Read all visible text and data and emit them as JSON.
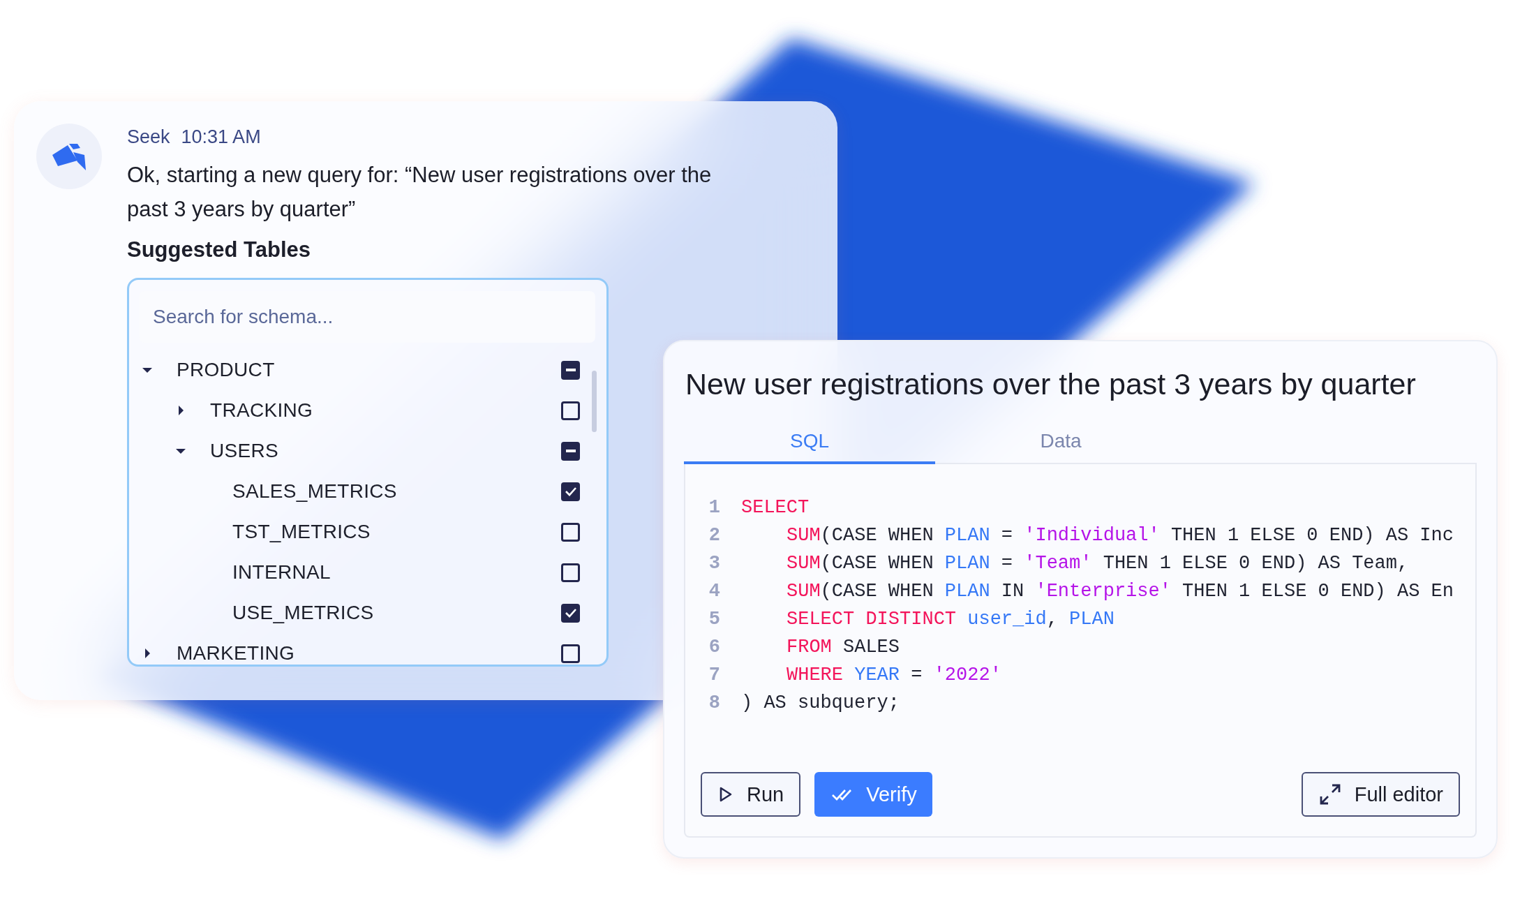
{
  "message": {
    "sender": "Seek",
    "time": "10:31 AM",
    "text": "Ok, starting a new query for: “New user registrations over the past 3 years by quarter”"
  },
  "suggested_tables": {
    "heading": "Suggested Tables",
    "search": {
      "placeholder": "Search for schema..."
    },
    "tree": [
      {
        "label": "PRODUCT",
        "expanded": true,
        "indeterminate": true,
        "children": [
          {
            "label": "TRACKING",
            "expanded": false,
            "checked": false
          },
          {
            "label": "USERS",
            "expanded": true,
            "indeterminate": true,
            "children": [
              {
                "label": "SALES_METRICS",
                "checked": true
              },
              {
                "label": "TST_METRICS",
                "checked": false
              },
              {
                "label": "INTERNAL",
                "checked": false
              },
              {
                "label": "USE_METRICS",
                "checked": true
              }
            ]
          }
        ]
      },
      {
        "label": "MARKETING",
        "expanded": false,
        "checked": false
      }
    ]
  },
  "query_panel": {
    "title": "New user registrations over the past 3 years by quarter",
    "tabs": [
      {
        "label": "SQL",
        "selected": true
      },
      {
        "label": "Data",
        "selected": false
      }
    ],
    "code": [
      {
        "number": "1",
        "indented": false,
        "tokens": [
          {
            "kind": "keyword",
            "text": "SELECT"
          }
        ]
      },
      {
        "number": "2",
        "indented": true,
        "tokens": [
          {
            "kind": "keyword",
            "text": "SUM"
          },
          {
            "kind": "plain",
            "text": "(CASE WHEN "
          },
          {
            "kind": "ident",
            "text": "PLAN"
          },
          {
            "kind": "plain",
            "text": " = "
          },
          {
            "kind": "string",
            "text": "'Individual'"
          },
          {
            "kind": "plain",
            "text": " THEN 1 ELSE 0 END) AS Inc"
          }
        ]
      },
      {
        "number": "3",
        "indented": true,
        "tokens": [
          {
            "kind": "keyword",
            "text": "SUM"
          },
          {
            "kind": "plain",
            "text": "(CASE WHEN "
          },
          {
            "kind": "ident",
            "text": "PLAN"
          },
          {
            "kind": "plain",
            "text": " = "
          },
          {
            "kind": "string",
            "text": "'Team'"
          },
          {
            "kind": "plain",
            "text": " THEN 1 ELSE 0 END) AS Team,"
          }
        ]
      },
      {
        "number": "4",
        "indented": true,
        "tokens": [
          {
            "kind": "keyword",
            "text": "SUM"
          },
          {
            "kind": "plain",
            "text": "(CASE WHEN "
          },
          {
            "kind": "ident",
            "text": "PLAN"
          },
          {
            "kind": "plain",
            "text": " IN "
          },
          {
            "kind": "string",
            "text": "'Enterprise'"
          },
          {
            "kind": "plain",
            "text": " THEN 1 ELSE 0 END) AS En"
          }
        ]
      },
      {
        "number": "5",
        "indented": true,
        "tokens": [
          {
            "kind": "keyword",
            "text": "SELECT DISTINCT"
          },
          {
            "kind": "ident",
            "text": " user_id"
          },
          {
            "kind": "plain",
            "text": ", "
          },
          {
            "kind": "ident",
            "text": "PLAN"
          }
        ]
      },
      {
        "number": "6",
        "indented": true,
        "tokens": [
          {
            "kind": "keyword",
            "text": "FROM"
          },
          {
            "kind": "plain",
            "text": " SALES"
          }
        ]
      },
      {
        "number": "7",
        "indented": true,
        "tokens": [
          {
            "kind": "keyword",
            "text": "WHERE"
          },
          {
            "kind": "ident",
            "text": " YEAR"
          },
          {
            "kind": "plain",
            "text": " = "
          },
          {
            "kind": "string",
            "text": "'2022'"
          }
        ]
      },
      {
        "number": "8",
        "indented": false,
        "tokens": [
          {
            "kind": "plain",
            "text": ") AS subquery;"
          }
        ]
      }
    ],
    "buttons": [
      {
        "kind": "run",
        "label": "Run"
      },
      {
        "kind": "verify",
        "label": "Verify"
      },
      {
        "kind": "expand",
        "label": "Full editor"
      }
    ]
  }
}
